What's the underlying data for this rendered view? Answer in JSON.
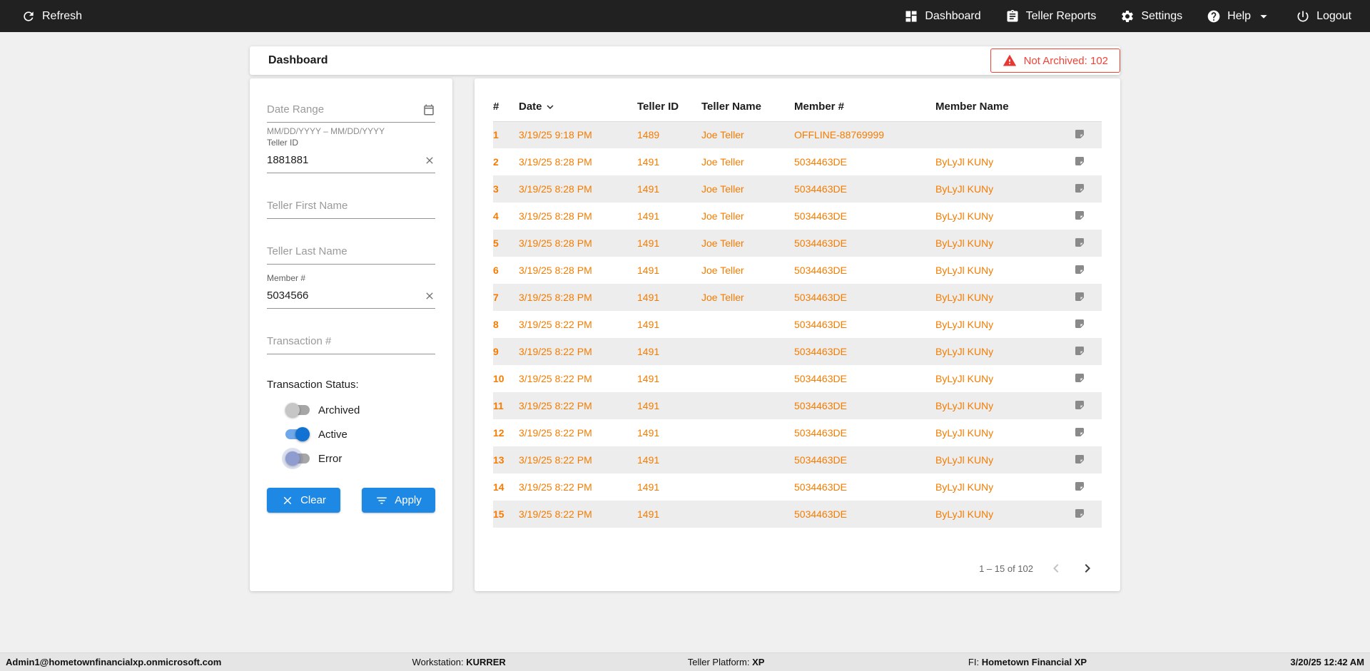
{
  "colors": {
    "topbar_bg": "#212121",
    "accent_orange": "#f57c00",
    "primary_blue": "#1e88e5",
    "alert_red": "#f44336",
    "page_bg": "#f0f0f0"
  },
  "topbar": {
    "refresh_label": "Refresh",
    "nav": [
      {
        "label": "Dashboard",
        "icon": "dashboard-icon"
      },
      {
        "label": "Teller Reports",
        "icon": "reports-icon"
      },
      {
        "label": "Settings",
        "icon": "settings-icon"
      },
      {
        "label": "Help",
        "icon": "help-icon"
      },
      {
        "label": "Logout",
        "icon": "logout-icon"
      }
    ]
  },
  "header": {
    "title": "Dashboard",
    "not_archived_badge": "Not Archived: 102"
  },
  "filters": {
    "date_range": {
      "placeholder": "Date Range",
      "helper": "MM/DD/YYYY – MM/DD/YYYY"
    },
    "teller_id": {
      "label": "Teller ID",
      "value": "1881881"
    },
    "teller_first_name": {
      "placeholder": "Teller First Name"
    },
    "teller_last_name": {
      "placeholder": "Teller Last Name"
    },
    "member_number": {
      "label": "Member #",
      "value": "5034566"
    },
    "transaction_number": {
      "placeholder": "Transaction #"
    },
    "status_label": "Transaction Status:",
    "toggles": [
      {
        "label": "Archived",
        "state": "off"
      },
      {
        "label": "Active",
        "state": "on"
      },
      {
        "label": "Error",
        "state": "off"
      }
    ],
    "clear_label": "Clear",
    "apply_label": "Apply"
  },
  "table": {
    "columns": [
      "#",
      "Date",
      "Teller ID",
      "Teller Name",
      "Member #",
      "Member Name"
    ],
    "sort": {
      "column": "Date",
      "direction": "desc"
    },
    "rows": [
      {
        "num": "1",
        "date": "3/19/25 9:18 PM",
        "teller_id": "1489",
        "teller_name": "Joe Teller",
        "member_number": "OFFLINE-88769999",
        "member_name": ""
      },
      {
        "num": "2",
        "date": "3/19/25 8:28 PM",
        "teller_id": "1491",
        "teller_name": "Joe Teller",
        "member_number": "5034463DE",
        "member_name": "ByLyJl KUNy"
      },
      {
        "num": "3",
        "date": "3/19/25 8:28 PM",
        "teller_id": "1491",
        "teller_name": "Joe Teller",
        "member_number": "5034463DE",
        "member_name": "ByLyJl KUNy"
      },
      {
        "num": "4",
        "date": "3/19/25 8:28 PM",
        "teller_id": "1491",
        "teller_name": "Joe Teller",
        "member_number": "5034463DE",
        "member_name": "ByLyJl KUNy"
      },
      {
        "num": "5",
        "date": "3/19/25 8:28 PM",
        "teller_id": "1491",
        "teller_name": "Joe Teller",
        "member_number": "5034463DE",
        "member_name": "ByLyJl KUNy"
      },
      {
        "num": "6",
        "date": "3/19/25 8:28 PM",
        "teller_id": "1491",
        "teller_name": "Joe Teller",
        "member_number": "5034463DE",
        "member_name": "ByLyJl KUNy"
      },
      {
        "num": "7",
        "date": "3/19/25 8:28 PM",
        "teller_id": "1491",
        "teller_name": "Joe Teller",
        "member_number": "5034463DE",
        "member_name": "ByLyJl KUNy"
      },
      {
        "num": "8",
        "date": "3/19/25 8:22 PM",
        "teller_id": "1491",
        "teller_name": "",
        "member_number": "5034463DE",
        "member_name": "ByLyJl KUNy"
      },
      {
        "num": "9",
        "date": "3/19/25 8:22 PM",
        "teller_id": "1491",
        "teller_name": "",
        "member_number": "5034463DE",
        "member_name": "ByLyJl KUNy"
      },
      {
        "num": "10",
        "date": "3/19/25 8:22 PM",
        "teller_id": "1491",
        "teller_name": "",
        "member_number": "5034463DE",
        "member_name": "ByLyJl KUNy"
      },
      {
        "num": "11",
        "date": "3/19/25 8:22 PM",
        "teller_id": "1491",
        "teller_name": "",
        "member_number": "5034463DE",
        "member_name": "ByLyJl KUNy"
      },
      {
        "num": "12",
        "date": "3/19/25 8:22 PM",
        "teller_id": "1491",
        "teller_name": "",
        "member_number": "5034463DE",
        "member_name": "ByLyJl KUNy"
      },
      {
        "num": "13",
        "date": "3/19/25 8:22 PM",
        "teller_id": "1491",
        "teller_name": "",
        "member_number": "5034463DE",
        "member_name": "ByLyJl KUNy"
      },
      {
        "num": "14",
        "date": "3/19/25 8:22 PM",
        "teller_id": "1491",
        "teller_name": "",
        "member_number": "5034463DE",
        "member_name": "ByLyJl KUNy"
      },
      {
        "num": "15",
        "date": "3/19/25 8:22 PM",
        "teller_id": "1491",
        "teller_name": "",
        "member_number": "5034463DE",
        "member_name": "ByLyJl KUNy"
      }
    ],
    "pagination": {
      "range_label": "1 – 15 of 102"
    }
  },
  "statusbar": {
    "user": "Admin1@hometownfinancialxp.onmicrosoft.com",
    "workstation_label": "Workstation:",
    "workstation_value": "KURRER",
    "platform_label": "Teller Platform:",
    "platform_value": "XP",
    "fi_label": "FI:",
    "fi_value": "Hometown Financial XP",
    "datetime": "3/20/25 12:42 AM"
  }
}
